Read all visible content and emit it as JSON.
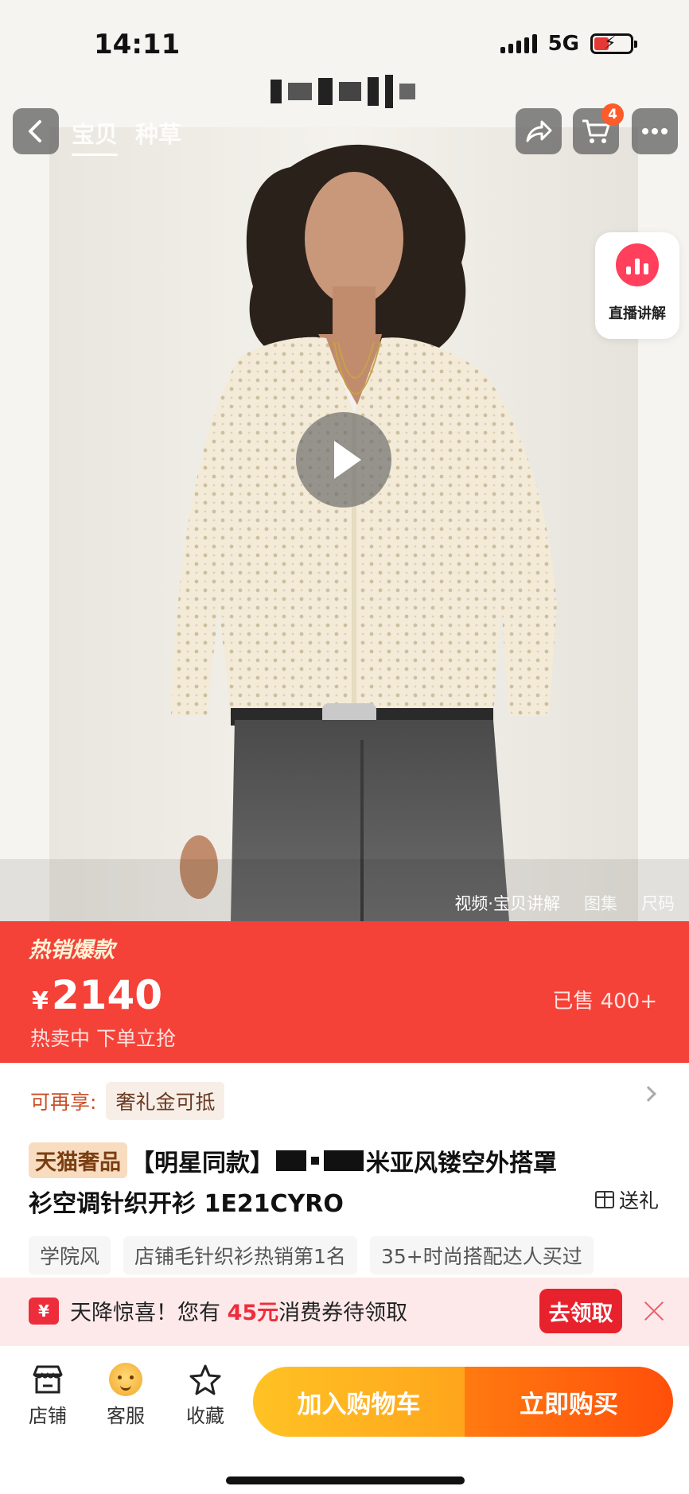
{
  "status": {
    "time": "14:11",
    "network": "5G"
  },
  "nav": {
    "tabs": [
      "宝贝",
      "种草"
    ],
    "cart_count": "4"
  },
  "live": {
    "label": "直播讲解"
  },
  "media_tabs": [
    "视频·宝贝讲解",
    "图集",
    "尺码"
  ],
  "price": {
    "hot_tag": "热销爆款",
    "currency": "¥",
    "value": "2140",
    "sold": "已售 400+",
    "note": "热卖中 下单立抢"
  },
  "perk": {
    "label": "可再享:",
    "chip": "奢礼金可抵"
  },
  "title": {
    "brand_tag": "天猫奢品",
    "line1_prefix": "【明星同款】",
    "line1_suffix": "米亚风镂空外搭罩",
    "line2": "衫空调针织开衫 1E21CYRO",
    "gift": "送礼"
  },
  "tags": [
    "学院风",
    "店铺毛针织衫热销第1名",
    "35+时尚搭配达人买过"
  ],
  "coupon": {
    "icon": "¥",
    "text_before": "天降惊喜！您有 ",
    "amount": "45元",
    "text_after": "消费券待领取",
    "button": "去领取"
  },
  "bottom": {
    "store": "店铺",
    "service": "客服",
    "favorite": "收藏",
    "add_cart": "加入购物车",
    "buy_now": "立即购买"
  },
  "colors": {
    "accent_red": "#f44239",
    "cart_yellow": "#ffb320",
    "buy_orange": "#ff5a0c"
  },
  "icons": [
    "back-icon",
    "share-icon",
    "cart-icon",
    "more-icon",
    "live-icon",
    "play-icon",
    "gift-icon",
    "store-icon",
    "service-icon",
    "star-icon",
    "close-icon",
    "coupon-icon",
    "chevron-right-icon"
  ]
}
